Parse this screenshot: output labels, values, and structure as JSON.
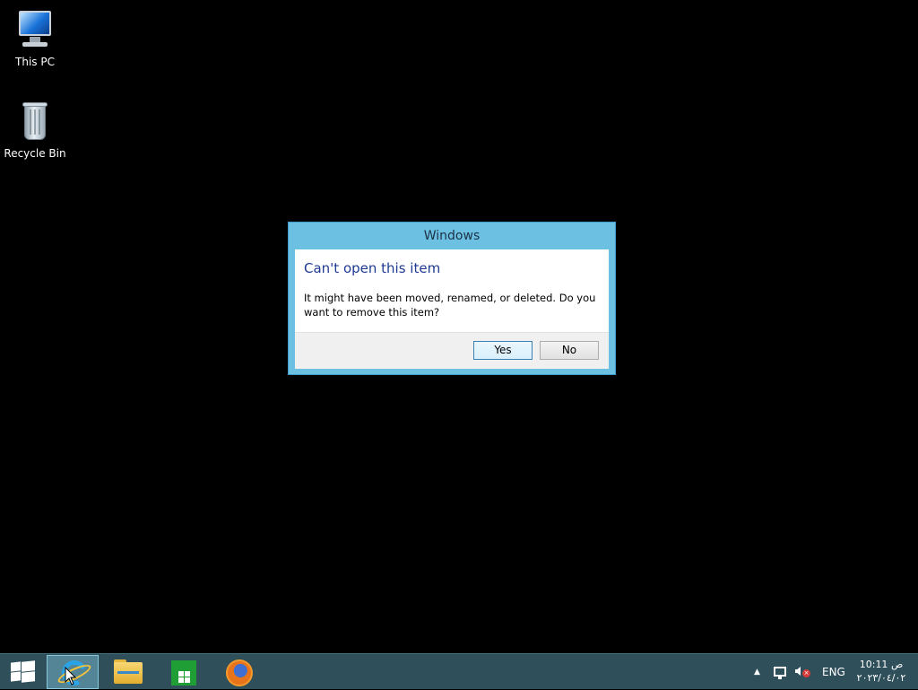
{
  "desktop": {
    "icons": [
      {
        "label": "This PC",
        "icon": "computer-icon"
      },
      {
        "label": "Recycle Bin",
        "icon": "recycle-bin-icon"
      }
    ]
  },
  "dialog": {
    "title": "Windows",
    "heading": "Can't open this item",
    "message": "It might have been moved, renamed, or deleted. Do you want to remove this item?",
    "buttons": {
      "yes": "Yes",
      "no": "No"
    }
  },
  "taskbar": {
    "pinned": [
      {
        "name": "internet-explorer-icon",
        "active": true
      },
      {
        "name": "file-explorer-icon",
        "active": false
      },
      {
        "name": "store-icon",
        "active": false
      },
      {
        "name": "firefox-icon",
        "active": false
      }
    ],
    "tray": {
      "chevron": "▲",
      "language": "ENG",
      "time": "10:11 ص",
      "date": "٢٠٢٣/٠٤/٠٢"
    }
  },
  "colors": {
    "dialog_frame": "#6cc1e2",
    "dialog_heading": "#1f3a93",
    "taskbar": "#2f4f5a"
  }
}
